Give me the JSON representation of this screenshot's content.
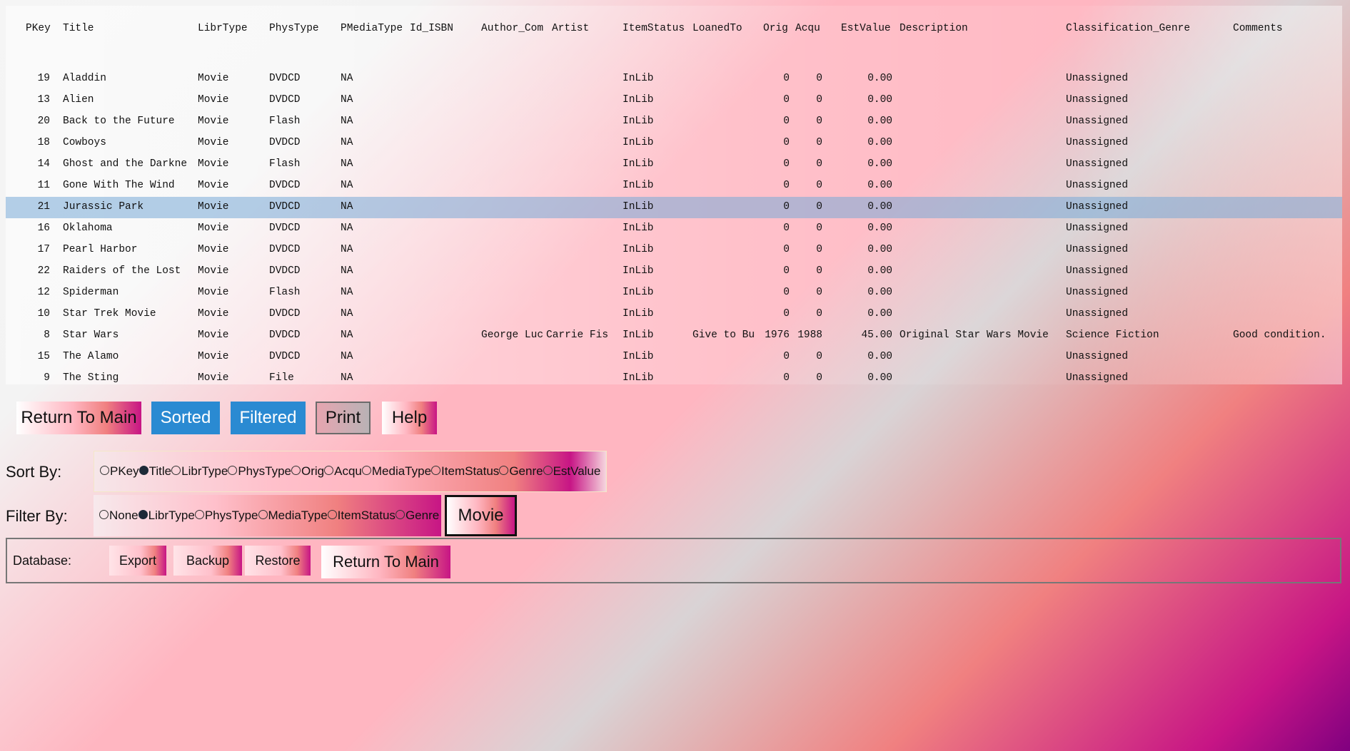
{
  "grid": {
    "columns": [
      "PKey",
      "Title",
      "LibrType",
      "PhysType",
      "PMediaType",
      "Id_ISBN",
      "Author_Com",
      "Artist",
      "ItemStatus",
      "LoanedTo",
      "Orig",
      "Acqu",
      "EstValue",
      "Description",
      "Classification_Genre",
      "Comments"
    ],
    "rows": [
      {
        "pkey": "19",
        "title": "Aladdin",
        "libr": "Movie",
        "phys": "DVDCD",
        "media": "NA",
        "isbn": "",
        "author": "",
        "artist": "",
        "status": "InLib",
        "loaned": "",
        "orig": "0",
        "acqu": "0",
        "est": "0.00",
        "desc": "",
        "genre": "Unassigned",
        "comments": ""
      },
      {
        "pkey": "13",
        "title": "Alien",
        "libr": "Movie",
        "phys": "DVDCD",
        "media": "NA",
        "isbn": "",
        "author": "",
        "artist": "",
        "status": "InLib",
        "loaned": "",
        "orig": "0",
        "acqu": "0",
        "est": "0.00",
        "desc": "",
        "genre": "Unassigned",
        "comments": ""
      },
      {
        "pkey": "20",
        "title": "Back to the Future",
        "libr": "Movie",
        "phys": "Flash",
        "media": "NA",
        "isbn": "",
        "author": "",
        "artist": "",
        "status": "InLib",
        "loaned": "",
        "orig": "0",
        "acqu": "0",
        "est": "0.00",
        "desc": "",
        "genre": "Unassigned",
        "comments": ""
      },
      {
        "pkey": "18",
        "title": "Cowboys",
        "libr": "Movie",
        "phys": "DVDCD",
        "media": "NA",
        "isbn": "",
        "author": "",
        "artist": "",
        "status": "InLib",
        "loaned": "",
        "orig": "0",
        "acqu": "0",
        "est": "0.00",
        "desc": "",
        "genre": "Unassigned",
        "comments": ""
      },
      {
        "pkey": "14",
        "title": "Ghost and the Darkne",
        "libr": "Movie",
        "phys": "Flash",
        "media": "NA",
        "isbn": "",
        "author": "",
        "artist": "",
        "status": "InLib",
        "loaned": "",
        "orig": "0",
        "acqu": "0",
        "est": "0.00",
        "desc": "",
        "genre": "Unassigned",
        "comments": ""
      },
      {
        "pkey": "11",
        "title": "Gone With The Wind",
        "libr": "Movie",
        "phys": "DVDCD",
        "media": "NA",
        "isbn": "",
        "author": "",
        "artist": "",
        "status": "InLib",
        "loaned": "",
        "orig": "0",
        "acqu": "0",
        "est": "0.00",
        "desc": "",
        "genre": "Unassigned",
        "comments": ""
      },
      {
        "pkey": "21",
        "title": "Jurassic Park",
        "libr": "Movie",
        "phys": "DVDCD",
        "media": "NA",
        "isbn": "",
        "author": "",
        "artist": "",
        "status": "InLib",
        "loaned": "",
        "orig": "0",
        "acqu": "0",
        "est": "0.00",
        "desc": "",
        "genre": "Unassigned",
        "comments": "",
        "selected": true
      },
      {
        "pkey": "16",
        "title": "Oklahoma",
        "libr": "Movie",
        "phys": "DVDCD",
        "media": "NA",
        "isbn": "",
        "author": "",
        "artist": "",
        "status": "InLib",
        "loaned": "",
        "orig": "0",
        "acqu": "0",
        "est": "0.00",
        "desc": "",
        "genre": "Unassigned",
        "comments": ""
      },
      {
        "pkey": "17",
        "title": "Pearl Harbor",
        "libr": "Movie",
        "phys": "DVDCD",
        "media": "NA",
        "isbn": "",
        "author": "",
        "artist": "",
        "status": "InLib",
        "loaned": "",
        "orig": "0",
        "acqu": "0",
        "est": "0.00",
        "desc": "",
        "genre": "Unassigned",
        "comments": ""
      },
      {
        "pkey": "22",
        "title": "Raiders of the Lost",
        "libr": "Movie",
        "phys": "DVDCD",
        "media": "NA",
        "isbn": "",
        "author": "",
        "artist": "",
        "status": "InLib",
        "loaned": "",
        "orig": "0",
        "acqu": "0",
        "est": "0.00",
        "desc": "",
        "genre": "Unassigned",
        "comments": ""
      },
      {
        "pkey": "12",
        "title": "Spiderman",
        "libr": "Movie",
        "phys": "Flash",
        "media": "NA",
        "isbn": "",
        "author": "",
        "artist": "",
        "status": "InLib",
        "loaned": "",
        "orig": "0",
        "acqu": "0",
        "est": "0.00",
        "desc": "",
        "genre": "Unassigned",
        "comments": ""
      },
      {
        "pkey": "10",
        "title": "Star Trek Movie",
        "libr": "Movie",
        "phys": "DVDCD",
        "media": "NA",
        "isbn": "",
        "author": "",
        "artist": "",
        "status": "InLib",
        "loaned": "",
        "orig": "0",
        "acqu": "0",
        "est": "0.00",
        "desc": "",
        "genre": "Unassigned",
        "comments": ""
      },
      {
        "pkey": "8",
        "title": "Star Wars",
        "libr": "Movie",
        "phys": "DVDCD",
        "media": "NA",
        "isbn": "",
        "author": "George Luc",
        "artist": "Carrie Fis",
        "status": "InLib",
        "loaned": "Give to Bu",
        "orig": "1976",
        "acqu": "1988",
        "est": "45.00",
        "desc": "Original Star Wars Movie",
        "genre": "Science Fiction",
        "comments": "Good condition."
      },
      {
        "pkey": "15",
        "title": "The Alamo",
        "libr": "Movie",
        "phys": "DVDCD",
        "media": "NA",
        "isbn": "",
        "author": "",
        "artist": "",
        "status": "InLib",
        "loaned": "",
        "orig": "0",
        "acqu": "0",
        "est": "0.00",
        "desc": "",
        "genre": "Unassigned",
        "comments": ""
      },
      {
        "pkey": "9",
        "title": "The Sting",
        "libr": "Movie",
        "phys": "File",
        "media": "NA",
        "isbn": "",
        "author": "",
        "artist": "",
        "status": "InLib",
        "loaned": "",
        "orig": "0",
        "acqu": "0",
        "est": "0.00",
        "desc": "",
        "genre": "Unassigned",
        "comments": ""
      }
    ]
  },
  "actions": {
    "return_main": "Return To Main",
    "sorted": "Sorted",
    "filtered": "Filtered",
    "print": "Print",
    "help": "Help"
  },
  "sort": {
    "label": "Sort By:",
    "options": [
      "PKey",
      "Title",
      "LibrType",
      "PhysType",
      "Orig",
      "Acqu",
      "MediaType",
      "ItemStatus",
      "Genre",
      "EstValue"
    ],
    "selected": "Title"
  },
  "filter": {
    "label": "Filter By:",
    "options": [
      "None",
      "LibrType",
      "PhysType",
      "MediaType",
      "ItemStatus",
      "Genre"
    ],
    "selected": "LibrType",
    "value": "Movie"
  },
  "database": {
    "label": "Database:",
    "export": "Export",
    "backup": "Backup",
    "restore": "Restore",
    "return_main": "Return To Main"
  },
  "colors": {
    "selected_row": "#8fb4d6",
    "blue_button": "#2a8ad2",
    "radio_on": "#1d2a38"
  }
}
